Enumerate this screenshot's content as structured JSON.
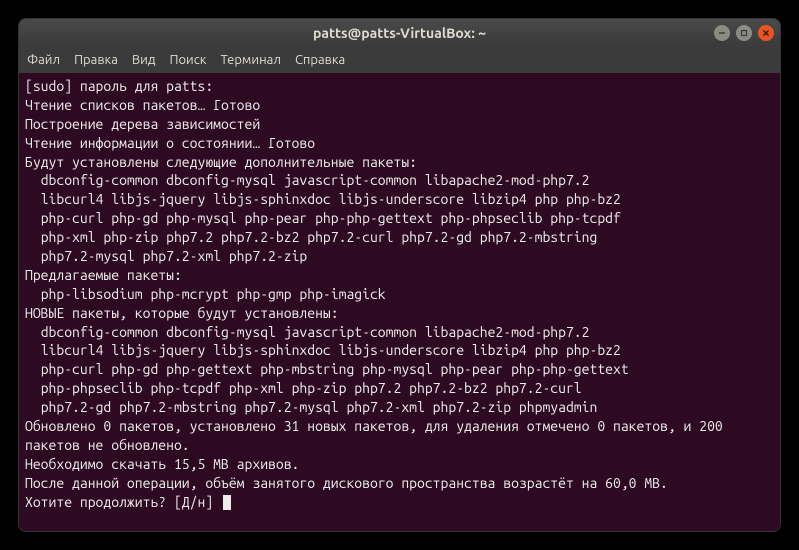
{
  "window": {
    "title": "patts@patts-VirtualBox: ~"
  },
  "menu": {
    "file": "Файл",
    "edit": "Правка",
    "view": "Вид",
    "search": "Поиск",
    "terminal": "Терминал",
    "help": "Справка"
  },
  "terminal": {
    "lines": [
      "[sudo] пароль для patts:",
      "Чтение списков пакетов… Готово",
      "Построение дерева зависимостей",
      "Чтение информации о состоянии… Готово",
      "Будут установлены следующие дополнительные пакеты:",
      "  dbconfig-common dbconfig-mysql javascript-common libapache2-mod-php7.2",
      "  libcurl4 libjs-jquery libjs-sphinxdoc libjs-underscore libzip4 php php-bz2",
      "  php-curl php-gd php-mysql php-pear php-php-gettext php-phpseclib php-tcpdf",
      "  php-xml php-zip php7.2 php7.2-bz2 php7.2-curl php7.2-gd php7.2-mbstring",
      "  php7.2-mysql php7.2-xml php7.2-zip",
      "Предлагаемые пакеты:",
      "  php-libsodium php-mcrypt php-gmp php-imagick",
      "НОВЫЕ пакеты, которые будут установлены:",
      "  dbconfig-common dbconfig-mysql javascript-common libapache2-mod-php7.2",
      "  libcurl4 libjs-jquery libjs-sphinxdoc libjs-underscore libzip4 php php-bz2",
      "  php-curl php-gd php-gettext php-mbstring php-mysql php-pear php-php-gettext",
      "  php-phpseclib php-tcpdf php-xml php-zip php7.2 php7.2-bz2 php7.2-curl",
      "  php7.2-gd php7.2-mbstring php7.2-mysql php7.2-xml php7.2-zip phpmyadmin",
      "Обновлено 0 пакетов, установлено 31 новых пакетов, для удаления отмечено 0 пакетов, и 200 пакетов не обновлено.",
      "Необходимо скачать 15,5 MB архивов.",
      "После данной операции, объём занятого дискового пространства возрастёт на 60,0 MB.",
      "Хотите продолжить? [Д/н] "
    ]
  }
}
